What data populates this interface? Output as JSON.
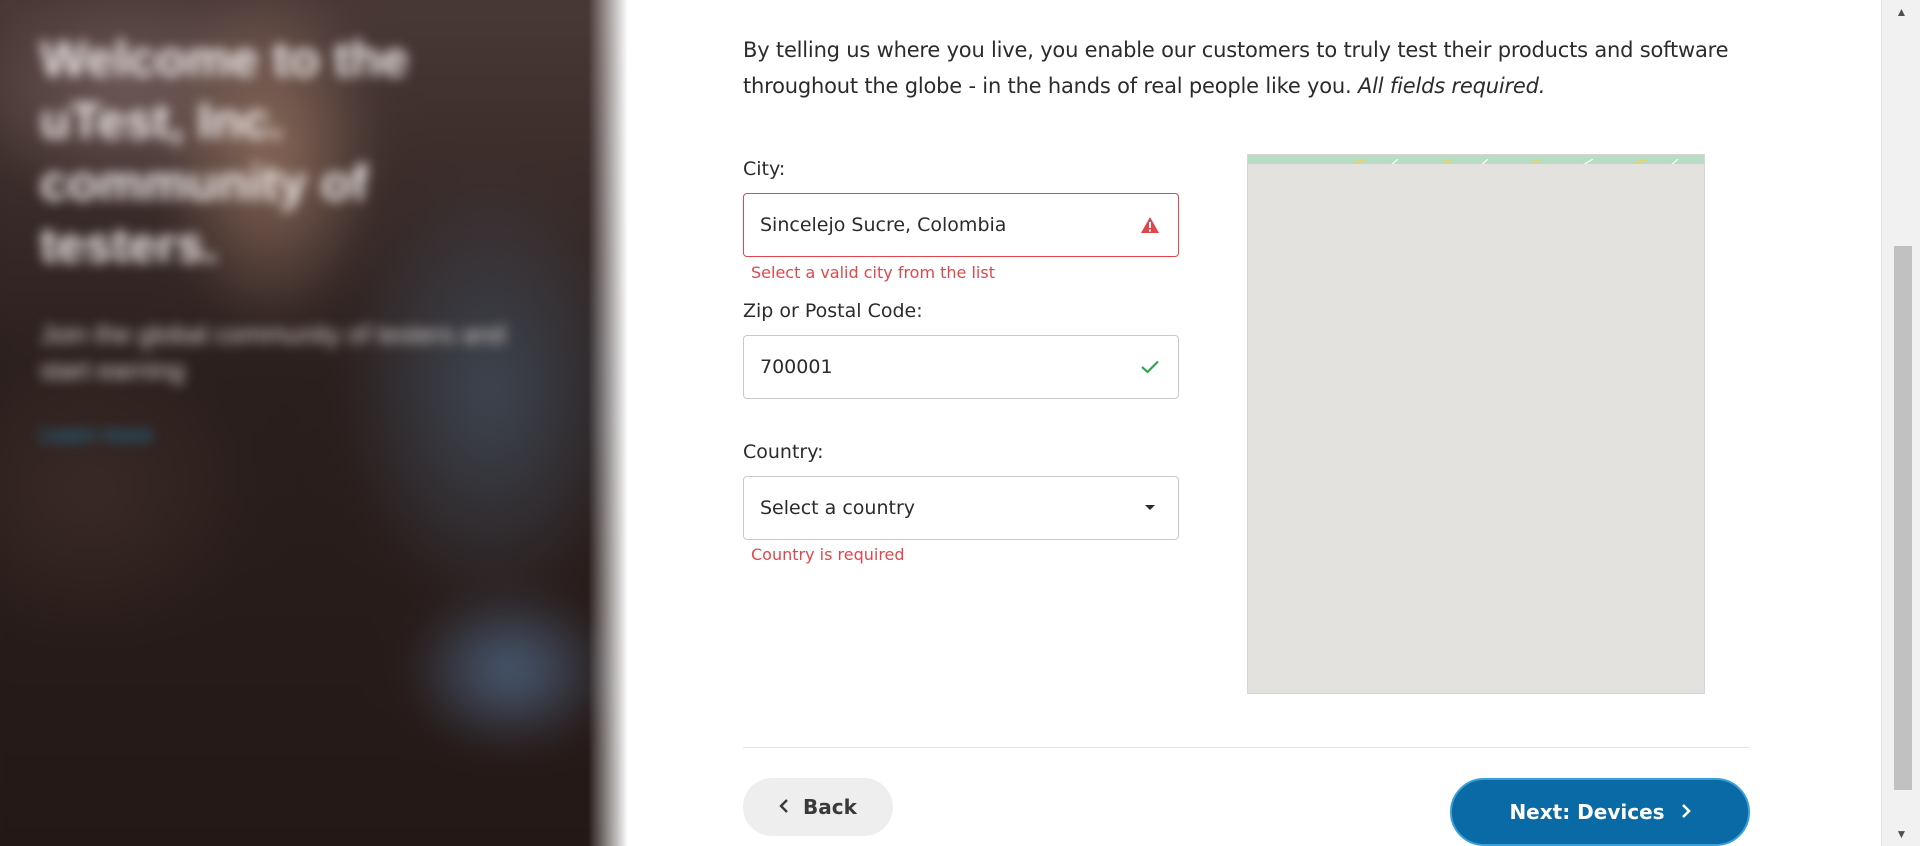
{
  "hero": {
    "title_lines": [
      "Welcome to the",
      "uTest, Inc.",
      "community of",
      "testers."
    ],
    "subtitle": "Join the global community of testers and start earning",
    "link": "Learn more"
  },
  "intro": {
    "text": "By telling us where you live, you enable our customers to truly test their products and software throughout the globe - in the hands of real people like you.",
    "required_note": "All fields required."
  },
  "city": {
    "label": "City:",
    "value": "Sincelejo Sucre, Colombia",
    "error": "Select a valid city from the list",
    "status_icon": "warning-icon"
  },
  "zip": {
    "label": "Zip or Postal Code:",
    "value": "700001",
    "status_icon": "checkmark-icon"
  },
  "country": {
    "label": "Country:",
    "placeholder": "Select a country",
    "error": "Country is required"
  },
  "buttons": {
    "back": "Back",
    "next": "Next: Devices"
  },
  "colors": {
    "error": "#e0474c",
    "success": "#2fa84f",
    "primary": "#0a6aa6"
  }
}
